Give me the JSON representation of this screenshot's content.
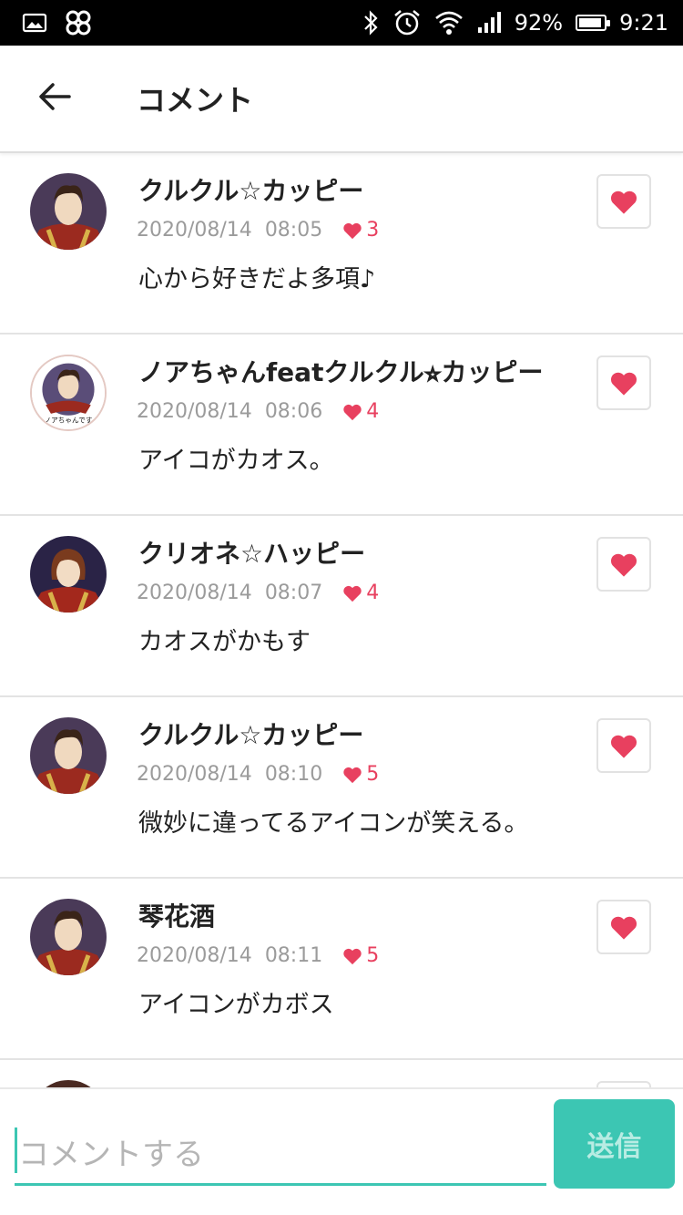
{
  "status_bar": {
    "battery": "92%",
    "time": "9:21",
    "battery_level": 0.92,
    "icons": [
      "image-icon",
      "pinwheel-icon",
      "bluetooth-icon",
      "alarm-icon",
      "wifi-icon",
      "signal-icon",
      "battery-icon"
    ]
  },
  "header": {
    "back_icon": "arrow-left-icon",
    "title": "コメント"
  },
  "comments": [
    {
      "user": "クルクル☆カッピー",
      "date": "2020/08/14",
      "time": "08:05",
      "likes": "3",
      "text": "心から好きだよ多項♪"
    },
    {
      "user": "ノアちゃんfeatクルクル⭐︎カッピー",
      "date": "2020/08/14",
      "time": "08:06",
      "likes": "4",
      "text": "アイコがカオス。",
      "avatar_caption": "ノアちゃんです"
    },
    {
      "user": "クリオネ☆ハッピー",
      "date": "2020/08/14",
      "time": "08:07",
      "likes": "4",
      "text": "カオスがかもす"
    },
    {
      "user": "クルクル☆カッピー",
      "date": "2020/08/14",
      "time": "08:10",
      "likes": "5",
      "text": "微妙に違ってるアイコンが笑える。"
    },
    {
      "user": "琴花酒",
      "date": "2020/08/14",
      "time": "08:11",
      "likes": "5",
      "text": "アイコンがカボス"
    }
  ],
  "composer": {
    "placeholder": "コメントする",
    "send_label": "送信"
  },
  "colors": {
    "accent": "#3cc6b3",
    "heart": "#e8405f",
    "meta_text": "#9b9b9b"
  }
}
